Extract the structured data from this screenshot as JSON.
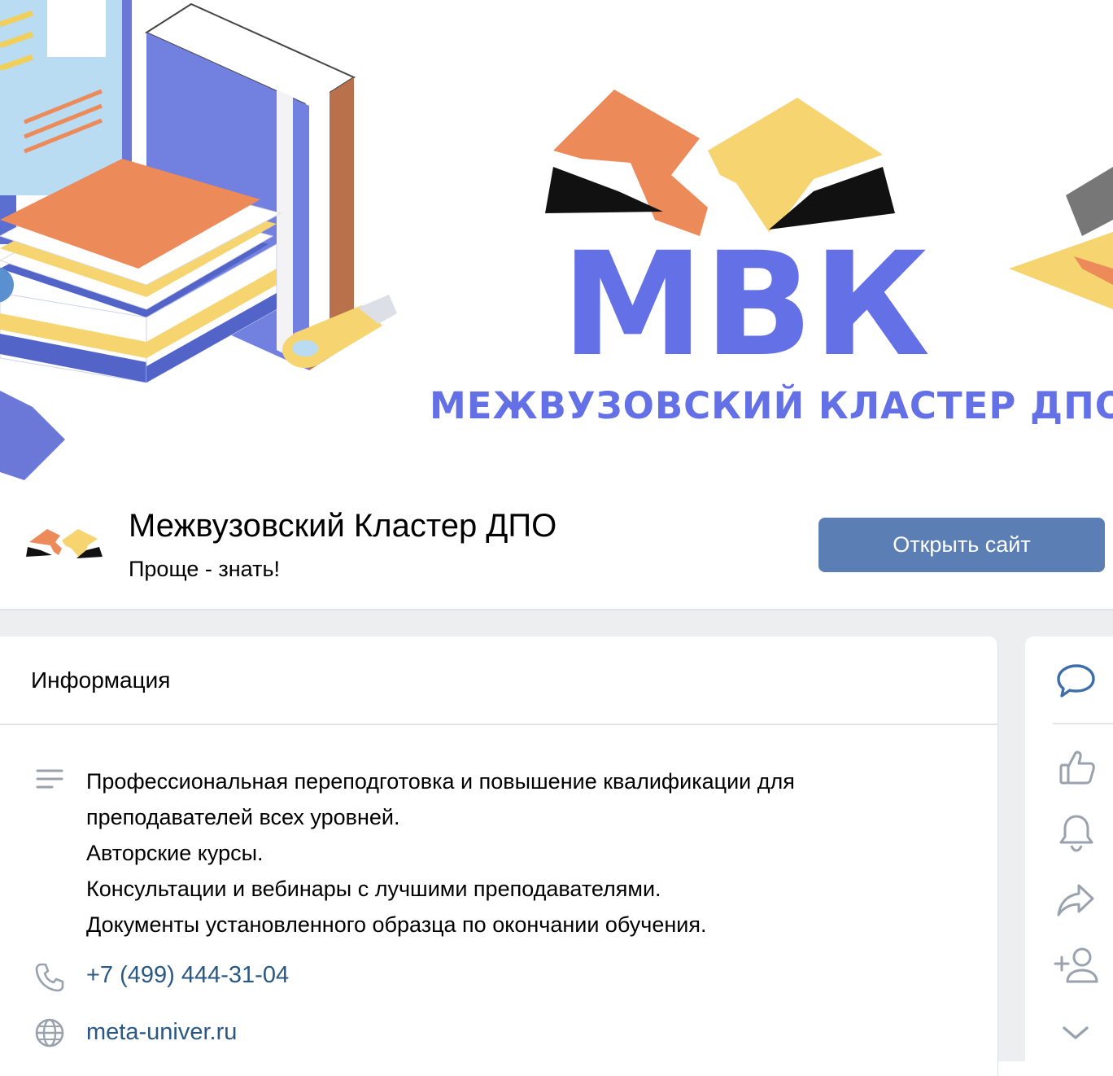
{
  "cover": {
    "logo_letters": "МВК",
    "logo_subtitle": "МЕЖВУЗОВСКИЙ КЛАСТЕР ДПО"
  },
  "header": {
    "name": "Межвузовский Кластер ДПО",
    "status": "Проще - знать!",
    "open_site_label": "Открыть сайт"
  },
  "info": {
    "title": "Информация",
    "description_lines": [
      "Профессиональная переподготовка и повышение квалификации для",
      "преподавателей всех уровней.",
      "Авторские курсы.",
      "Консультации и вебинары с лучшими преподавателями.",
      "Документы установленного образца по окончании обучения."
    ],
    "phone": "+7 (499) 444-31-04",
    "website": "meta-univer.ru"
  },
  "side_actions": [
    {
      "icon": "message-icon"
    },
    {
      "icon": "like-icon"
    },
    {
      "icon": "bell-icon"
    },
    {
      "icon": "share-icon"
    },
    {
      "icon": "add-friend-icon"
    },
    {
      "icon": "chevron-down-icon"
    }
  ],
  "colors": {
    "accent_button": "#5b7fb5",
    "link": "#2a5885",
    "logo_blue": "#6470e6",
    "logo_orange": "#ec8a5a",
    "logo_yellow": "#f6d470",
    "icon_blue": "#3f6fa8",
    "icon_gray": "#99a2ad"
  }
}
